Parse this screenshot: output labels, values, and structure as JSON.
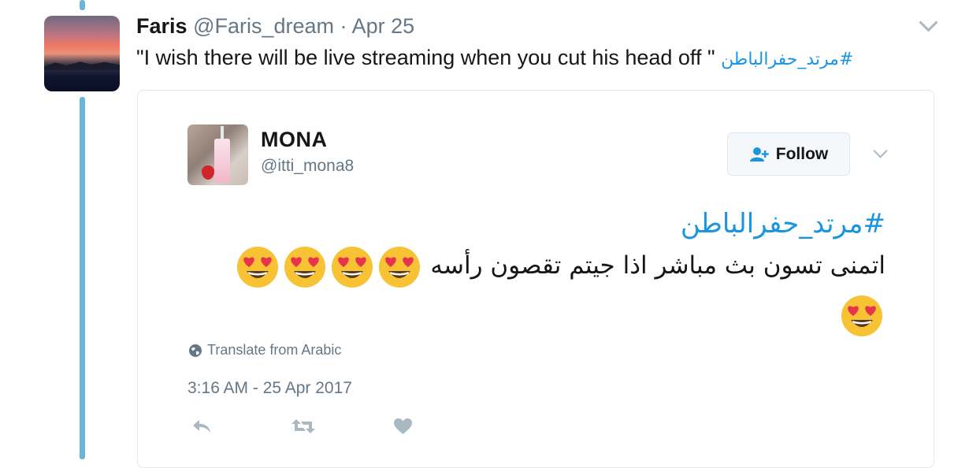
{
  "tweet": {
    "name": "Faris",
    "handle": "@Faris_dream",
    "separator": "·",
    "date": "Apr 25",
    "text_before": "\"I wish there will be live streaming when you cut his head off \"",
    "hashtag": "#مرتد_حفرالباطن"
  },
  "quoted": {
    "name": "MONA",
    "handle": "@itti_mona8",
    "follow_label": "Follow",
    "hashtag": "#مرتد_حفرالباطن",
    "text": "اتمنى تسون بث مباشر اذا جيتم تقصون رأسه",
    "emoji": "heart-eyes-emoji",
    "emoji_count": 5,
    "translate_label": "Translate from Arabic",
    "timestamp": "3:16 AM - 25 Apr 2017"
  },
  "colors": {
    "thread_line": "#6cb4d8",
    "hashtag": "#1b95e0",
    "muted": "#657786",
    "icon_gray": "#aab8c2"
  },
  "icons": [
    "caret-down-icon",
    "follow-person-icon",
    "globe-icon",
    "reply-icon",
    "retweet-icon",
    "like-heart-icon"
  ]
}
